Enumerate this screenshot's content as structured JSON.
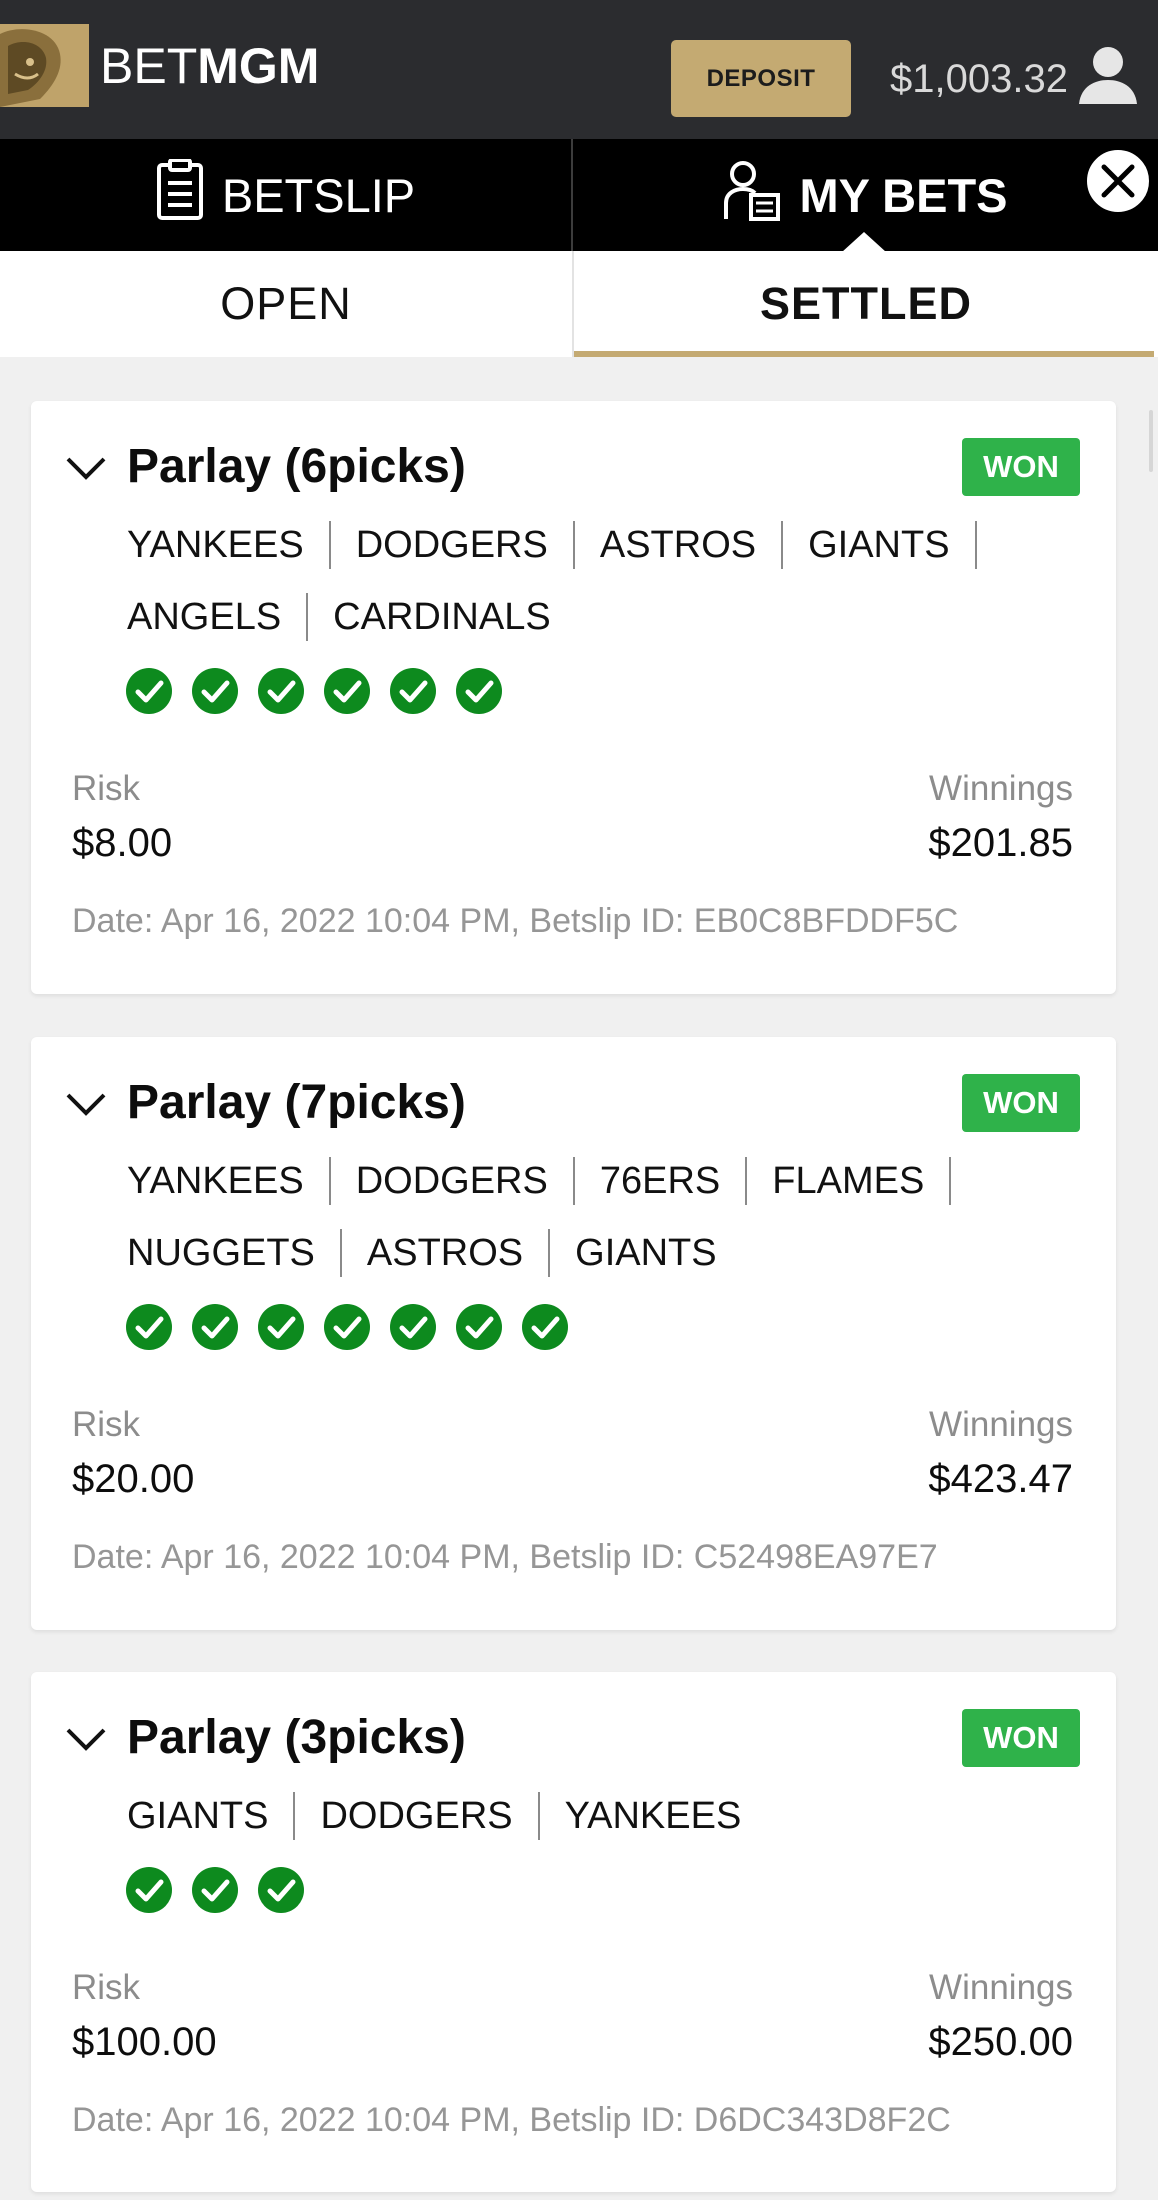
{
  "header": {
    "logo_light": "BET",
    "logo_bold": "MGM",
    "deposit_label": "DEPOSIT",
    "balance": "$1,003.32",
    "user_icon": "user-icon"
  },
  "tabs": {
    "betslip_label": "BETSLIP",
    "betslip_icon": "clipboard-icon",
    "mybets_label": "MY BETS",
    "mybets_icon": "user-list-icon",
    "close_icon": "close-icon"
  },
  "subtabs": {
    "open_label": "OPEN",
    "settled_label": "SETTLED",
    "active": "SETTLED"
  },
  "colors": {
    "header_bg": "#2b2c2f",
    "gold": "#c4aa72",
    "won_green": "#2fb24a",
    "check_green": "#0d8a1e"
  },
  "bets": [
    {
      "title": "Parlay (6picks)",
      "status": "WON",
      "picks_rows": [
        [
          "YANKEES",
          "DODGERS",
          "ASTROS",
          "GIANTS"
        ],
        [
          "ANGELS",
          "CARDINALS"
        ]
      ],
      "checks": 6,
      "risk_label": "Risk",
      "risk": "$8.00",
      "winnings_label": "Winnings",
      "winnings": "$201.85",
      "meta": "Date: Apr 16, 2022 10:04 PM, Betslip ID: EB0C8BFDDF5C"
    },
    {
      "title": "Parlay (7picks)",
      "status": "WON",
      "picks_rows": [
        [
          "YANKEES",
          "DODGERS",
          "76ERS",
          "FLAMES"
        ],
        [
          "NUGGETS",
          "ASTROS",
          "GIANTS"
        ]
      ],
      "checks": 7,
      "risk_label": "Risk",
      "risk": "$20.00",
      "winnings_label": "Winnings",
      "winnings": "$423.47",
      "meta": "Date: Apr 16, 2022 10:04 PM, Betslip ID: C52498EA97E7"
    },
    {
      "title": "Parlay (3picks)",
      "status": "WON",
      "picks_rows": [
        [
          "GIANTS",
          "DODGERS",
          "YANKEES"
        ]
      ],
      "checks": 3,
      "risk_label": "Risk",
      "risk": "$100.00",
      "winnings_label": "Winnings",
      "winnings": "$250.00",
      "meta": "Date: Apr 16, 2022 10:04 PM, Betslip ID: D6DC343D8F2C"
    }
  ]
}
